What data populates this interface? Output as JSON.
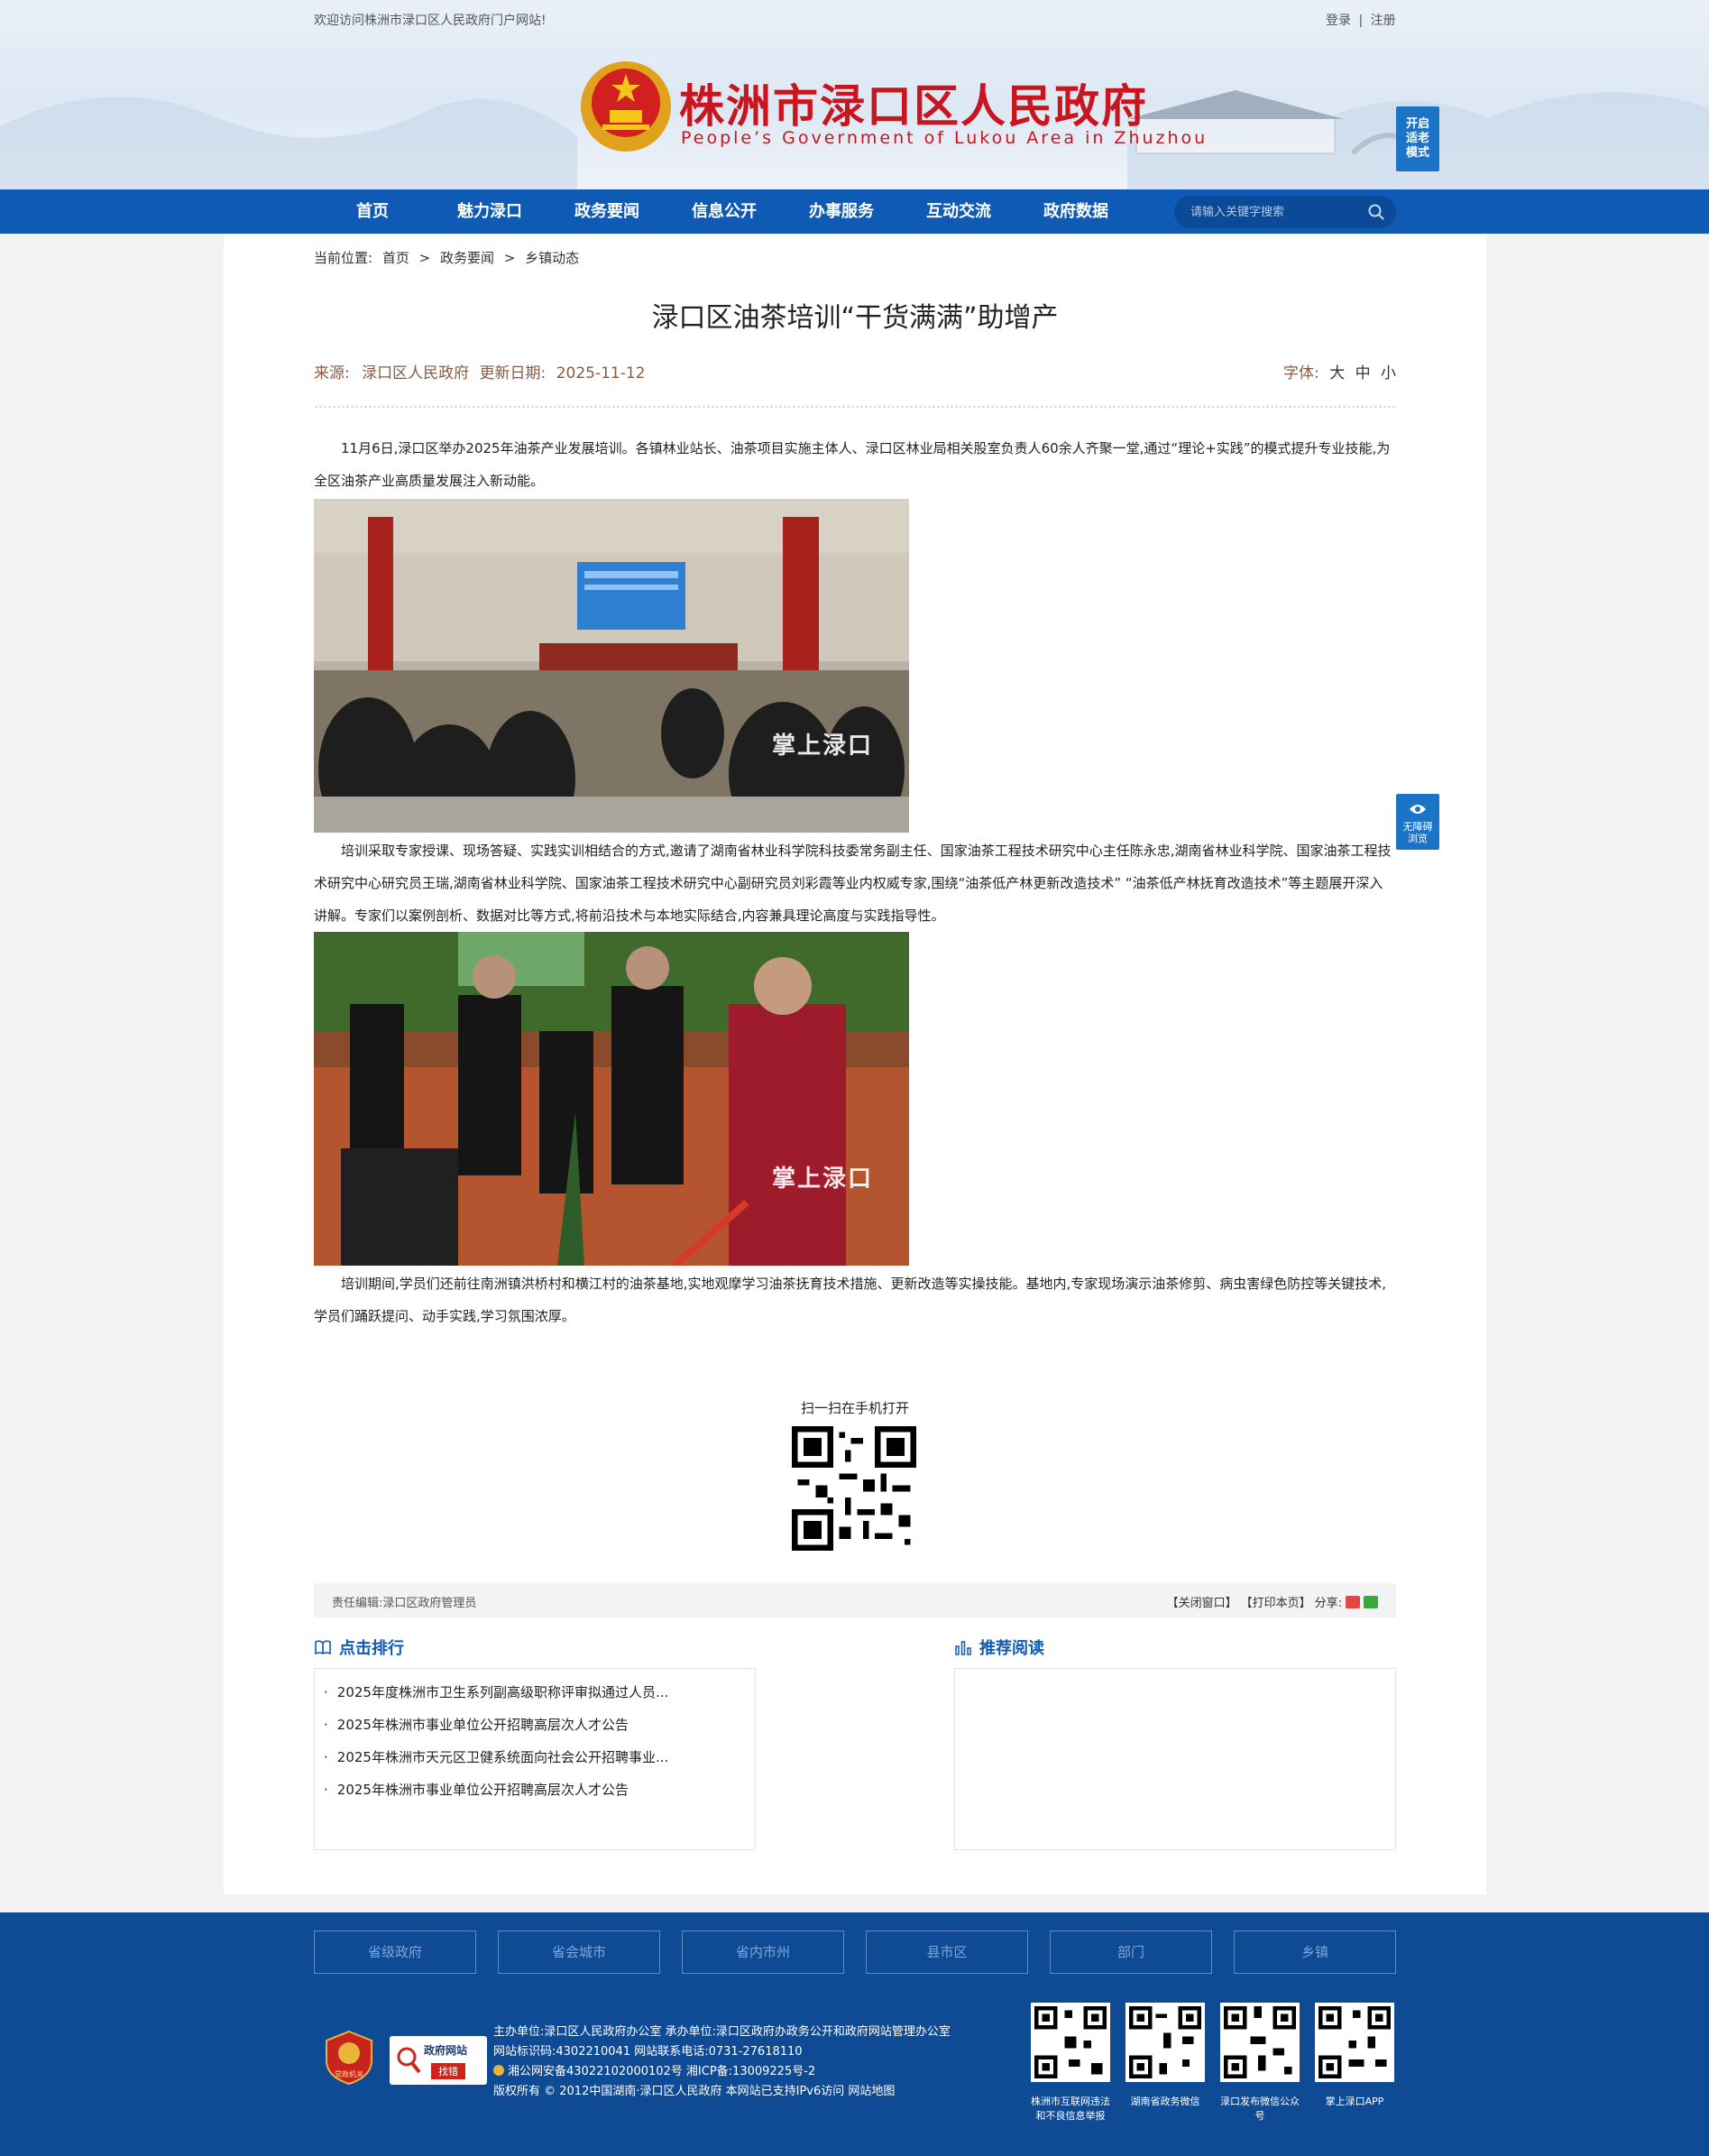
{
  "header": {
    "welcome": "欢迎访问株洲市渌口区人民政府门户网站!",
    "login": "登录",
    "separator": "|",
    "register": "注册",
    "site_title": "株洲市渌口区人民政府",
    "site_subtitle": "People’s Government of Lukou Area in Zhuzhou",
    "elder_mode": "开启适老模式"
  },
  "nav": {
    "items": [
      "首页",
      "魅力渌口",
      "政务要闻",
      "信息公开",
      "办事服务",
      "互动交流",
      "政府数据"
    ],
    "search_placeholder": "请输入关键字搜索"
  },
  "breadcrumb": {
    "label": "当前位置:",
    "items": [
      "首页",
      "政务要闻",
      "乡镇动态"
    ],
    "sep": ">"
  },
  "article": {
    "title": "渌口区油茶培训“干货满满”助增产",
    "source_label": "来源:",
    "source": "渌口区人民政府",
    "date_label": "更新日期:",
    "date": "2025-11-12",
    "font_label": "字体:",
    "font_sizes": [
      "大",
      "中",
      "小"
    ],
    "paragraphs": [
      "11月6日,渌口区举办2025年油茶产业发展培训。各镇林业站长、油茶项目实施主体人、渌口区林业局相关股室负责人60余人齐聚一堂,通过“理论+实践”的模式提升专业技能,为全区油茶产业高质量发展注入新动能。",
      "培训采取专家授课、现场答疑、实践实训相结合的方式,邀请了湖南省林业科学院科技委常务副主任、国家油茶工程技术研究中心主任陈永忠,湖南省林业科学院、国家油茶工程技术研究中心研究员王瑞,湖南省林业科学院、国家油茶工程技术研究中心副研究员刘彩霞等业内权威专家,围绕“油茶低产林更新改造技术” “油茶低产林抚育改造技术”等主题展开深入讲解。专家们以案例剖析、数据对比等方式,将前沿技术与本地实际结合,内容兼具理论高度与实践指导性。",
      "培训期间,学员们还前往南洲镇洪桥村和横江村的油茶基地,实地观摩学习油茶抚育技术措施、更新改造等实操技能。基地内,专家现场演示油茶修剪、病虫害绿色防控等关键技术,学员们踊跃提问、动手实践,学习氛围浓厚。"
    ],
    "watermark": "掌上渌口",
    "qr_caption": "扫一扫在手机打开",
    "editor_label": "责任编辑:",
    "editor": "渌口区政府管理员",
    "close_window": "【关闭窗口】",
    "print_page": "【打印本页】",
    "share_label": "分享:"
  },
  "sections": {
    "ranking_title": "点击排行",
    "ranking": [
      "2025年度株洲市卫生系列副高级职称评审拟通过人员...",
      "2025年株洲市事业单位公开招聘高层次人才公告",
      "2025年株洲市天元区卫健系统面向社会公开招聘事业...",
      "2025年株洲市事业单位公开招聘高层次人才公告"
    ],
    "recommend_title": "推荐阅读"
  },
  "float": {
    "accessible": "无障碍浏览"
  },
  "footer": {
    "links": [
      "省级政府",
      "省会城市",
      "省内市州",
      "县市区",
      "部门",
      "乡镇"
    ],
    "badge_top": "政府网站",
    "badge_bottom": "找错",
    "party_badge": "党政机关",
    "info_lines": [
      "主办单位:渌口区人民政府办公室 承办单位:渌口区政府办政务公开和政府网站管理办公室",
      "网站标识码:4302210041 网站联系电话:0731-27618110",
      "湘公网安备43022102000102号 湘ICP备:13009225号-2",
      "版权所有 © 2012中国湖南·渌口区人民政府 本网站已支持IPv6访问 网站地图"
    ],
    "qrs": [
      "株洲市互联网违法和不良信息举报",
      "湖南省政务微信",
      "渌口发布微信公众号",
      "掌上渌口APP"
    ]
  },
  "colors": {
    "brand_blue": "#0f5ab4",
    "title_red": "#c9161e",
    "footer_blue": "#0f4a95"
  }
}
